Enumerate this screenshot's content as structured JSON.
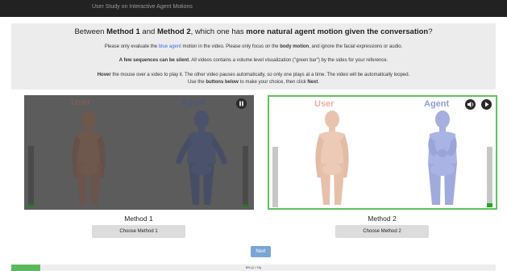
{
  "header": {
    "title": "User Study on Interactive Agent Motions"
  },
  "instructions": {
    "q_prefix": "Between ",
    "method1": "Method 1",
    "q_and": " and ",
    "method2": "Method 2",
    "q_mid": ", which one has ",
    "q_bold": "more natural agent motion given the conversation",
    "q_end": "?",
    "l1_a": "Please only evaluate the ",
    "l1_blue": "blue agent",
    "l1_b": " motion in the video. Please only focus on the ",
    "l1_bold": "body motion",
    "l1_c": ", and ignore the facial expressions or audio.",
    "l2_bold": "A few sequences can be silent",
    "l2_rest": ". All videos contains a volume level visualization (\"green bar\") by the sides for your reference.",
    "l3_bold": "Hover",
    "l3_rest": " the mouse over a video to play it. The other video pauses automatically, so only one plays at a time. The video will be automatically looped.",
    "l4_a": "Use the ",
    "l4_bold": "buttons below",
    "l4_b": " to make your choice, then click ",
    "l4_next": "Next",
    "l4_end": "."
  },
  "videos": [
    {
      "user_label": "User",
      "agent_label": "Agent",
      "method_label": "Method 1",
      "choose_label": "Choose Method 1",
      "state": "paused",
      "control_icon": "pause-icon",
      "left_volume": 0.04,
      "right_volume": 0.04
    },
    {
      "user_label": "User",
      "agent_label": "Agent",
      "method_label": "Method 2",
      "choose_label": "Choose Method 2",
      "state": "playing",
      "control_icons": [
        "volume-icon",
        "play-icon"
      ],
      "left_volume": 0.0,
      "right_volume": 0.07
    }
  ],
  "next_label": "Next",
  "progress": {
    "text": "6% (1 / 15)",
    "fraction": 0.06
  },
  "colors": {
    "selected_border": "#5ec25e",
    "volume_bar": "#22aa22",
    "next_button": "#7aa6d6",
    "agent_blue": "#3b6fd8"
  }
}
